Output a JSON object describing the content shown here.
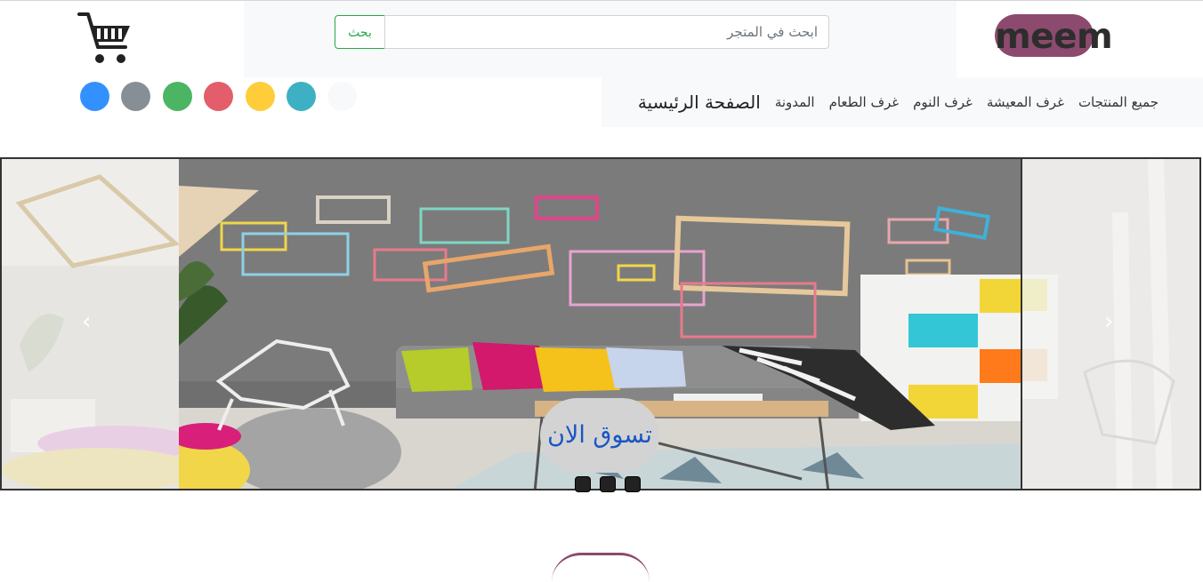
{
  "logo": {
    "text": "meem",
    "pill_color": "#8c4a6e"
  },
  "search": {
    "placeholder": "ابحث في المتجر",
    "button_label": "بحث"
  },
  "cart": {
    "icon": "cart-icon"
  },
  "nav": {
    "brand": "الصفحة الرئيسية",
    "links": [
      "المدونة",
      "غرف الطعام",
      "غرف النوم",
      "غرف المعيشة",
      "جميع المنتجات"
    ]
  },
  "color_swatches": [
    "#3390ff",
    "#878f96",
    "#4bb564",
    "#e35d6a",
    "#ffcd39",
    "#3db1c3",
    "#f8f9fa"
  ],
  "slider": {
    "cta_label": "تسوق الان",
    "prev_icon": "chevron-left-icon",
    "next_icon": "chevron-right-icon",
    "indicator_count": 3
  }
}
